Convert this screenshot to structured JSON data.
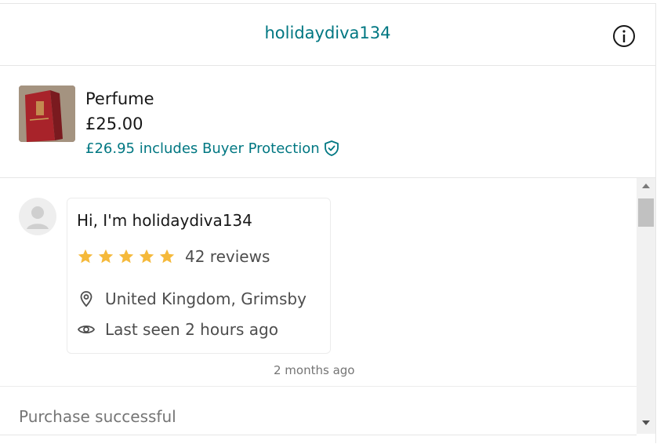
{
  "header": {
    "title": "holidaydiva134",
    "info_icon": "info-circle-icon"
  },
  "item": {
    "title": "Perfume",
    "price": "£25.00",
    "protection_text": "£26.95 includes Buyer Protection",
    "protection_icon": "shield-check-icon"
  },
  "seller_card": {
    "greeting": "Hi, I'm holidaydiva134",
    "rating": 5,
    "rating_max": 5,
    "reviews": "42 reviews",
    "location": "United Kingdom, Grimsby",
    "last_seen": "Last seen 2 hours ago"
  },
  "message": {
    "timestamp": "2 months ago"
  },
  "status": {
    "text": "Purchase successful"
  },
  "colors": {
    "accent": "#007782",
    "star": "#f5b93a",
    "muted_text": "#757575"
  }
}
